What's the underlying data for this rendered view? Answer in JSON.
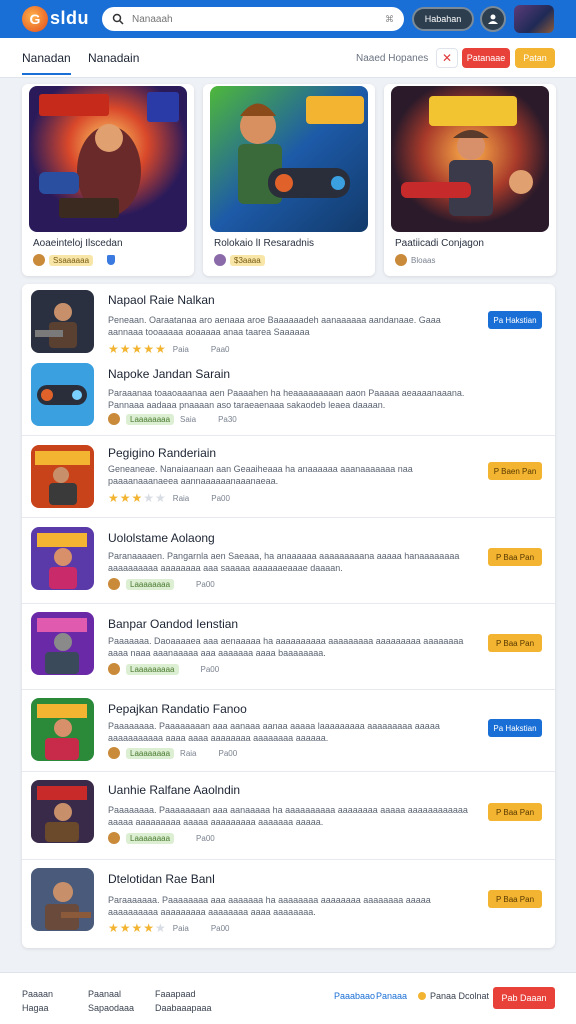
{
  "header": {
    "logo_text": "sldu",
    "search_placeholder": "Nanaaah",
    "search_shortcut": "⌘",
    "action_button": "Habahan"
  },
  "tabs": [
    {
      "label": "Nanadan",
      "active": true
    },
    {
      "label": "Nanadain",
      "active": false
    }
  ],
  "filter": {
    "label": "Naaed Hopanes",
    "close_symbol": "✕",
    "red_button": "Patanaae",
    "yellow_button": "Patan"
  },
  "featured": [
    {
      "title": "Aoaeinteloj Ilscedan",
      "tag": "Ssaaaaaa"
    },
    {
      "title": "Rolokaio lI Resaradnis",
      "tag": "$3aaaa"
    },
    {
      "title": "Paatiicadi Conjagon",
      "tag": "Bloaas"
    }
  ],
  "list": [
    {
      "title": "Napaol Raie Nalkan",
      "desc": "Peneaan. Oaraatanaa aro aenaaa aroe Baaaaaadeh aanaaaaaa aandanaae. Gaaa aannaaa tooaaaaa aoaaaaa anaa taarea Saaaaaa",
      "rating": 5,
      "rating_label": "Paia",
      "size": "Paa0",
      "button": "Pa Hakstian",
      "button_style": "blue"
    },
    {
      "title": "Napoke Jandan Sarain",
      "desc": "Paraaanaa toaaoaaanaa aen Paaaahen ha heaaaaaaaaan aaon Paaaaa aeaaaanaaana. Pannaaa aadaaa pnaaaan aso taraeaenaaa sakaodeb leaea daaaan.",
      "tag": "Laaaaaaaa",
      "rating_label": "Saia",
      "size": "Pa30",
      "button": "",
      "button_style": ""
    },
    {
      "title": "Pegigino Randeriain",
      "desc": "Geneaneae. Nanaiaanaan aan Geaaiheaaa ha anaaaaaa aaanaaaaaaa naa paaaanaaanaeea aannaaaaaanaaanaeaa.",
      "rating": 3,
      "rating_label": "Raia",
      "size": "Pa00",
      "button": "P Baen Pan",
      "button_style": "gold"
    },
    {
      "title": "Uololstame Aolaong",
      "desc": "Paranaaaaen. Pangarnla aen Saeaaa, ha anaaaaaa aaaaaaaaana aaaaa hanaaaaaaaa aaaaaaaaaa aaaaaaaa aaa saaaaa aaaaaaeaaae daaaan.",
      "tag": "Laaaaaaaa",
      "rating_label": "",
      "size": "Pa00",
      "button": "P Baa Pan",
      "button_style": "gold"
    },
    {
      "title": "Banpar Oandod Ienstian",
      "desc": "Paaaaaaa. Daoaaaaea aaa aenaaaaa ha aaaaaaaaaa aaaaaaaaa aaaaaaaaa aaaaaaaa aaaa naaa aaanaaaaa aaa aaaaaaa aaaa baaaaaaaa.",
      "tag": "Laaaaaaaaa",
      "rating_label": "",
      "size": "Pa00",
      "button": "P Baa Pan",
      "button_style": "gold"
    },
    {
      "title": "Pepajkan Randatio Fanoo",
      "desc": "Paaaaaaaa. Paaaaaaaan aaa aanaaa aanaa aaaaa laaaaaaaaa aaaaaaaaa aaaaa aaaaaaaaaaa aaaa aaaa aaaaaaaa aaaaaaaa aaaaaa.",
      "tag": "Laaaaaaaa",
      "rating_label": "Raia",
      "size": "Pa00",
      "button": "Pa Hakstian",
      "button_style": "blue"
    },
    {
      "title": "Uanhie Ralfane Aaolndin",
      "desc": "Paaaaaaaa. Paaaaaaaan aaa aanaaaaa ha aaaaaaaaaa aaaaaaaa aaaaa aaaaaaaaaaaa aaaaa aaaaaaaaa aaaaa aaaaaaaaa aaaaaaa aaaaa.",
      "tag": "Laaaaaaaa",
      "rating_label": "",
      "size": "Pa00",
      "button": "P Baa Pan",
      "button_style": "gold"
    },
    {
      "title": "Dtelotidan Rae Banl",
      "desc": "Paraaaaaaa. Paaaaaaaa aaa aaaaaaa ha aaaaaaaa aaaaaaaa aaaaaaaa aaaaa aaaaaaaaaa aaaaaaaaa aaaaaaaa aaaa aaaaaaaa.",
      "rating": 4,
      "rating_label": "Paia",
      "size": "Pa00",
      "button": "P Baa Pan",
      "button_style": "gold"
    }
  ],
  "footer": {
    "col1": [
      "Paaaan",
      "Hagaa"
    ],
    "col2": [
      "Paanaal",
      "Sapaodaaa"
    ],
    "col3": [
      "Faaapaad",
      "Daabaaapaaa"
    ],
    "link1": "Paaabaao",
    "link2": "Panaaa",
    "coin_text": "Panaa Dcolnat",
    "button": "Pab Daaan"
  }
}
